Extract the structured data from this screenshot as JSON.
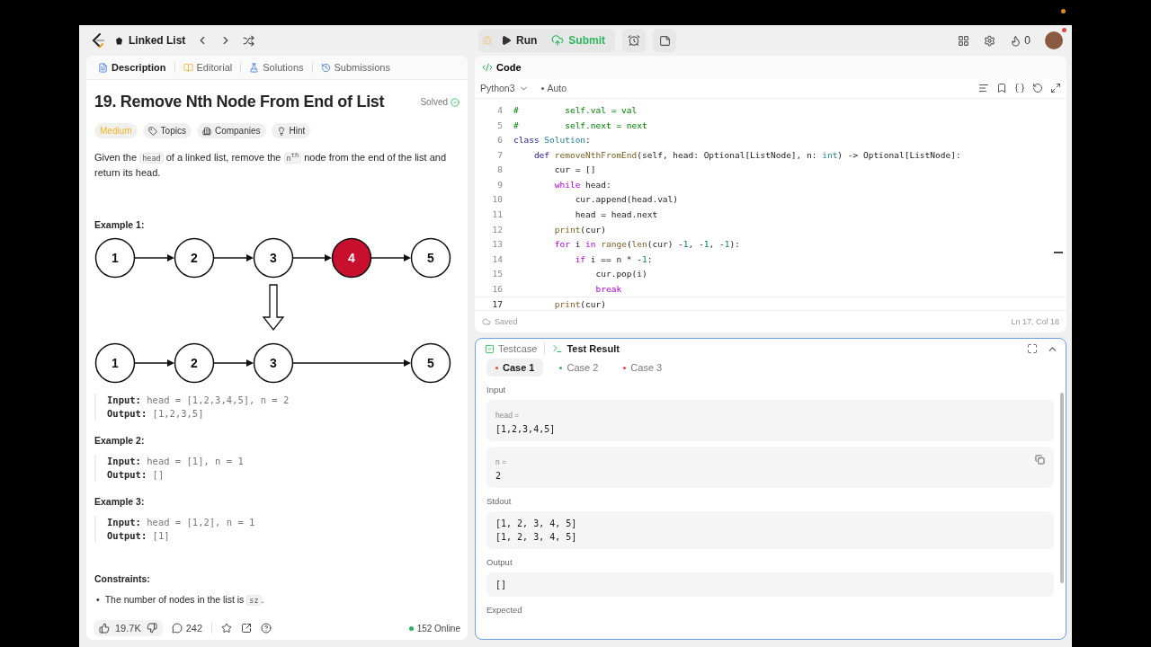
{
  "topbar": {
    "problem_list": "Linked List",
    "actions": [
      {
        "label": "Run",
        "kind": "run"
      },
      {
        "label": "Submit",
        "kind": "submit"
      }
    ],
    "streak": "0"
  },
  "description_tabs": [
    {
      "label": "Description",
      "kind": "description",
      "selected": true
    },
    {
      "label": "Editorial",
      "kind": "editorial",
      "selected": false
    },
    {
      "label": "Solutions",
      "kind": "solutions",
      "selected": false
    },
    {
      "label": "Submissions",
      "kind": "submissions",
      "selected": false
    }
  ],
  "problem": {
    "title": "19. Remove Nth Node From End of List",
    "status": "Solved",
    "difficulty": "Medium",
    "tags": [
      {
        "label": "Topics",
        "kind": "topics"
      },
      {
        "label": "Companies",
        "kind": "companies"
      },
      {
        "label": "Hint",
        "kind": "hint"
      }
    ],
    "statement": [
      {
        "kind": "text",
        "text": "Given the "
      },
      {
        "kind": "code",
        "text": "head"
      },
      {
        "kind": "text",
        "text": " of a linked list, remove the "
      },
      {
        "kind": "code",
        "text": "n$^{th}$"
      },
      {
        "kind": "text",
        "text": " node from the end of the list and return its head."
      }
    ],
    "examples": [
      {
        "title": "Example 1:",
        "diagram": {
          "before": [
            {
              "value": "1",
              "highlighted": false
            },
            {
              "value": "2",
              "highlighted": false
            },
            {
              "value": "3",
              "highlighted": false
            },
            {
              "value": "4",
              "highlighted": true
            },
            {
              "value": "5",
              "highlighted": false
            }
          ],
          "after": [
            {
              "kind": "node",
              "value": "1"
            },
            {
              "kind": "node",
              "value": "2"
            },
            {
              "kind": "node",
              "value": "3"
            },
            {
              "kind": "gap"
            },
            {
              "kind": "node",
              "value": "5"
            }
          ]
        },
        "lines": [
          {
            "label": "Input:",
            "value": "head = [1,2,3,4,5], n = 2"
          },
          {
            "label": "Output:",
            "value": "[1,2,3,5]"
          }
        ]
      },
      {
        "title": "Example 2:",
        "lines": [
          {
            "label": "Input:",
            "value": "head = [1], n = 1"
          },
          {
            "label": "Output:",
            "value": "[]"
          }
        ]
      },
      {
        "title": "Example 3:",
        "lines": [
          {
            "label": "Input:",
            "value": "head = [1,2], n = 1"
          },
          {
            "label": "Output:",
            "value": "[1]"
          }
        ]
      }
    ],
    "constraints_title": "Constraints:",
    "constraints": [
      {
        "marker": "•",
        "parts": [
          {
            "kind": "text",
            "text": "The number of nodes in the list is "
          },
          {
            "kind": "code",
            "text": "sz"
          },
          {
            "kind": "text",
            "text": "."
          }
        ]
      }
    ]
  },
  "footer": {
    "likes": "19.7K",
    "comments": "242",
    "online": "152 Online"
  },
  "code": {
    "title": "Code",
    "language": "Python3",
    "mode": "Auto",
    "status": "Saved",
    "cursor": "Ln 17, Col 18",
    "lines": [
      {
        "number": "4",
        "active": false,
        "tokens": [
          {
            "kind": "comment",
            "text": "#         self.val = val"
          }
        ]
      },
      {
        "number": "5",
        "active": false,
        "tokens": [
          {
            "kind": "comment",
            "text": "#         self.next = next"
          }
        ]
      },
      {
        "number": "6",
        "active": false,
        "tokens": [
          {
            "kind": "keyword",
            "text": "class"
          },
          {
            "kind": "type",
            "text": " Solution"
          },
          {
            "kind": "plain",
            "text": ":"
          }
        ]
      },
      {
        "number": "7",
        "active": false,
        "tokens": [
          {
            "kind": "keyword",
            "text": "    def"
          },
          {
            "kind": "func",
            "text": " removeNthFromEnd"
          },
          {
            "kind": "plain",
            "text": "(self, head: Optional[ListNode], n: "
          },
          {
            "kind": "type",
            "text": "int"
          },
          {
            "kind": "plain",
            "text": ") -> Optional[ListNode]:"
          }
        ]
      },
      {
        "number": "8",
        "active": false,
        "tokens": [
          {
            "kind": "plain",
            "text": "        cur = []"
          }
        ]
      },
      {
        "number": "9",
        "active": false,
        "tokens": [
          {
            "kind": "control",
            "text": "        while"
          },
          {
            "kind": "plain",
            "text": " head:"
          }
        ]
      },
      {
        "number": "10",
        "active": false,
        "tokens": [
          {
            "kind": "plain",
            "text": "            cur.append(head.val)"
          }
        ]
      },
      {
        "number": "11",
        "active": false,
        "tokens": [
          {
            "kind": "plain",
            "text": "            head = head.next"
          }
        ]
      },
      {
        "number": "12",
        "active": false,
        "tokens": [
          {
            "kind": "func",
            "text": "        print"
          },
          {
            "kind": "plain",
            "text": "(cur)"
          }
        ]
      },
      {
        "number": "13",
        "active": false,
        "tokens": [
          {
            "kind": "control",
            "text": "        for"
          },
          {
            "kind": "plain",
            "text": " i "
          },
          {
            "kind": "control",
            "text": "in"
          },
          {
            "kind": "func",
            "text": " range"
          },
          {
            "kind": "plain",
            "text": "("
          },
          {
            "kind": "func",
            "text": "len"
          },
          {
            "kind": "plain",
            "text": "(cur) -"
          },
          {
            "kind": "number",
            "text": "1"
          },
          {
            "kind": "plain",
            "text": ", -"
          },
          {
            "kind": "number",
            "text": "1"
          },
          {
            "kind": "plain",
            "text": ", -"
          },
          {
            "kind": "number",
            "text": "1"
          },
          {
            "kind": "plain",
            "text": "):"
          }
        ]
      },
      {
        "number": "14",
        "active": false,
        "tokens": [
          {
            "kind": "control",
            "text": "            if"
          },
          {
            "kind": "plain",
            "text": " i == n * -"
          },
          {
            "kind": "number",
            "text": "1"
          },
          {
            "kind": "plain",
            "text": ":"
          }
        ]
      },
      {
        "number": "15",
        "active": false,
        "tokens": [
          {
            "kind": "plain",
            "text": "                cur.pop(i)"
          }
        ]
      },
      {
        "number": "16",
        "active": false,
        "tokens": [
          {
            "kind": "control",
            "text": "                break"
          }
        ]
      },
      {
        "number": "17",
        "active": true,
        "tokens": [
          {
            "kind": "func",
            "text": "        print"
          },
          {
            "kind": "plain",
            "text": "(cur)"
          }
        ]
      }
    ]
  },
  "test_panel": {
    "tabs": [
      {
        "label": "Testcase",
        "kind": "testcase",
        "selected": false
      },
      {
        "label": "Test Result",
        "kind": "result",
        "selected": true
      }
    ],
    "cases": [
      {
        "label": "Case 1",
        "selected": true,
        "color": "#e0484d"
      },
      {
        "label": "Case 2",
        "selected": false,
        "color": "#3cae68"
      },
      {
        "label": "Case 3",
        "selected": false,
        "color": "#e0484d"
      }
    ],
    "sections": [
      {
        "title": "Input",
        "blocks": [
          {
            "name": "head =",
            "value": "[1,2,3,4,5]",
            "copyable": false
          },
          {
            "name": "n =",
            "value": "2",
            "copyable": true
          }
        ]
      },
      {
        "title": "Stdout",
        "blocks": [
          {
            "value": "[1, 2, 3, 4, 5]\n[1, 2, 3, 4, 5]",
            "copyable": false
          }
        ]
      },
      {
        "title": "Output",
        "blocks": [
          {
            "value": "[]",
            "copyable": false
          }
        ]
      },
      {
        "title": "Expected"
      }
    ]
  }
}
